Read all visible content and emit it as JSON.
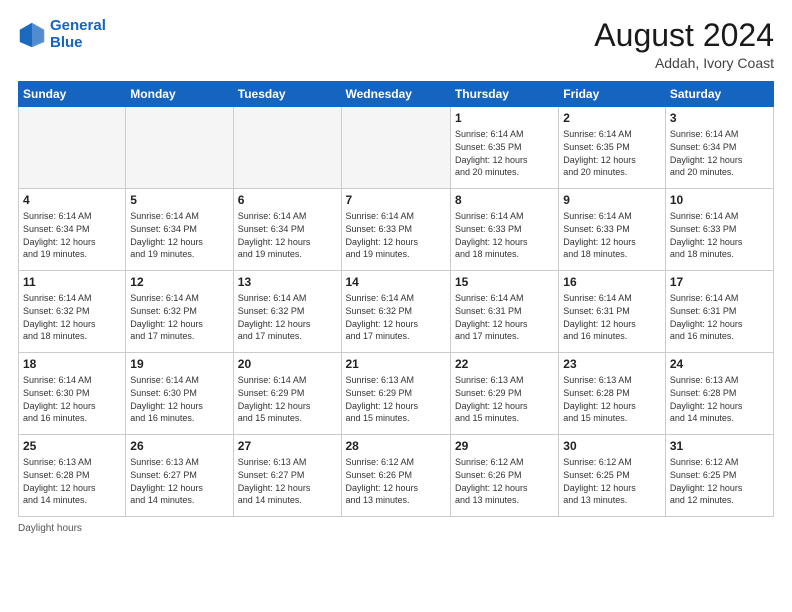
{
  "header": {
    "logo_line1": "General",
    "logo_line2": "Blue",
    "month_title": "August 2024",
    "location": "Addah, Ivory Coast"
  },
  "days_of_week": [
    "Sunday",
    "Monday",
    "Tuesday",
    "Wednesday",
    "Thursday",
    "Friday",
    "Saturday"
  ],
  "weeks": [
    [
      {
        "day": "",
        "detail": ""
      },
      {
        "day": "",
        "detail": ""
      },
      {
        "day": "",
        "detail": ""
      },
      {
        "day": "",
        "detail": ""
      },
      {
        "day": "1",
        "detail": "Sunrise: 6:14 AM\nSunset: 6:35 PM\nDaylight: 12 hours\nand 20 minutes."
      },
      {
        "day": "2",
        "detail": "Sunrise: 6:14 AM\nSunset: 6:35 PM\nDaylight: 12 hours\nand 20 minutes."
      },
      {
        "day": "3",
        "detail": "Sunrise: 6:14 AM\nSunset: 6:34 PM\nDaylight: 12 hours\nand 20 minutes."
      }
    ],
    [
      {
        "day": "4",
        "detail": "Sunrise: 6:14 AM\nSunset: 6:34 PM\nDaylight: 12 hours\nand 19 minutes."
      },
      {
        "day": "5",
        "detail": "Sunrise: 6:14 AM\nSunset: 6:34 PM\nDaylight: 12 hours\nand 19 minutes."
      },
      {
        "day": "6",
        "detail": "Sunrise: 6:14 AM\nSunset: 6:34 PM\nDaylight: 12 hours\nand 19 minutes."
      },
      {
        "day": "7",
        "detail": "Sunrise: 6:14 AM\nSunset: 6:33 PM\nDaylight: 12 hours\nand 19 minutes."
      },
      {
        "day": "8",
        "detail": "Sunrise: 6:14 AM\nSunset: 6:33 PM\nDaylight: 12 hours\nand 18 minutes."
      },
      {
        "day": "9",
        "detail": "Sunrise: 6:14 AM\nSunset: 6:33 PM\nDaylight: 12 hours\nand 18 minutes."
      },
      {
        "day": "10",
        "detail": "Sunrise: 6:14 AM\nSunset: 6:33 PM\nDaylight: 12 hours\nand 18 minutes."
      }
    ],
    [
      {
        "day": "11",
        "detail": "Sunrise: 6:14 AM\nSunset: 6:32 PM\nDaylight: 12 hours\nand 18 minutes."
      },
      {
        "day": "12",
        "detail": "Sunrise: 6:14 AM\nSunset: 6:32 PM\nDaylight: 12 hours\nand 17 minutes."
      },
      {
        "day": "13",
        "detail": "Sunrise: 6:14 AM\nSunset: 6:32 PM\nDaylight: 12 hours\nand 17 minutes."
      },
      {
        "day": "14",
        "detail": "Sunrise: 6:14 AM\nSunset: 6:32 PM\nDaylight: 12 hours\nand 17 minutes."
      },
      {
        "day": "15",
        "detail": "Sunrise: 6:14 AM\nSunset: 6:31 PM\nDaylight: 12 hours\nand 17 minutes."
      },
      {
        "day": "16",
        "detail": "Sunrise: 6:14 AM\nSunset: 6:31 PM\nDaylight: 12 hours\nand 16 minutes."
      },
      {
        "day": "17",
        "detail": "Sunrise: 6:14 AM\nSunset: 6:31 PM\nDaylight: 12 hours\nand 16 minutes."
      }
    ],
    [
      {
        "day": "18",
        "detail": "Sunrise: 6:14 AM\nSunset: 6:30 PM\nDaylight: 12 hours\nand 16 minutes."
      },
      {
        "day": "19",
        "detail": "Sunrise: 6:14 AM\nSunset: 6:30 PM\nDaylight: 12 hours\nand 16 minutes."
      },
      {
        "day": "20",
        "detail": "Sunrise: 6:14 AM\nSunset: 6:29 PM\nDaylight: 12 hours\nand 15 minutes."
      },
      {
        "day": "21",
        "detail": "Sunrise: 6:13 AM\nSunset: 6:29 PM\nDaylight: 12 hours\nand 15 minutes."
      },
      {
        "day": "22",
        "detail": "Sunrise: 6:13 AM\nSunset: 6:29 PM\nDaylight: 12 hours\nand 15 minutes."
      },
      {
        "day": "23",
        "detail": "Sunrise: 6:13 AM\nSunset: 6:28 PM\nDaylight: 12 hours\nand 15 minutes."
      },
      {
        "day": "24",
        "detail": "Sunrise: 6:13 AM\nSunset: 6:28 PM\nDaylight: 12 hours\nand 14 minutes."
      }
    ],
    [
      {
        "day": "25",
        "detail": "Sunrise: 6:13 AM\nSunset: 6:28 PM\nDaylight: 12 hours\nand 14 minutes."
      },
      {
        "day": "26",
        "detail": "Sunrise: 6:13 AM\nSunset: 6:27 PM\nDaylight: 12 hours\nand 14 minutes."
      },
      {
        "day": "27",
        "detail": "Sunrise: 6:13 AM\nSunset: 6:27 PM\nDaylight: 12 hours\nand 14 minutes."
      },
      {
        "day": "28",
        "detail": "Sunrise: 6:12 AM\nSunset: 6:26 PM\nDaylight: 12 hours\nand 13 minutes."
      },
      {
        "day": "29",
        "detail": "Sunrise: 6:12 AM\nSunset: 6:26 PM\nDaylight: 12 hours\nand 13 minutes."
      },
      {
        "day": "30",
        "detail": "Sunrise: 6:12 AM\nSunset: 6:25 PM\nDaylight: 12 hours\nand 13 minutes."
      },
      {
        "day": "31",
        "detail": "Sunrise: 6:12 AM\nSunset: 6:25 PM\nDaylight: 12 hours\nand 12 minutes."
      }
    ]
  ],
  "legend": {
    "daylight_hours": "Daylight hours"
  }
}
